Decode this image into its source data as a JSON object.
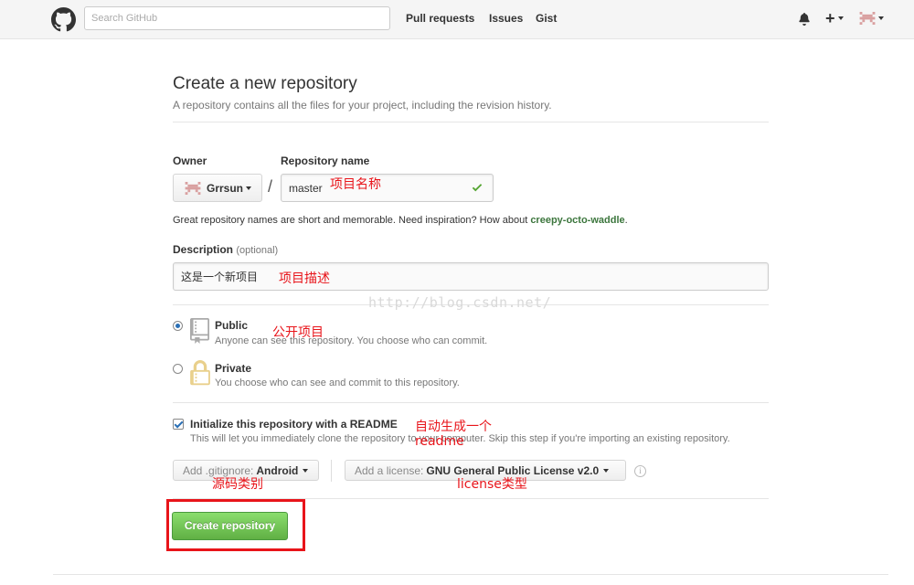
{
  "header": {
    "search_placeholder": "Search GitHub",
    "nav": [
      "Pull requests",
      "Issues",
      "Gist"
    ],
    "plus_label": "+",
    "icons": [
      "github-logo-icon",
      "bell-icon",
      "plus-icon",
      "avatar-icon"
    ]
  },
  "page": {
    "title": "Create a new repository",
    "subtitle": "A repository contains all the files for your project, including the revision history."
  },
  "owner": {
    "label": "Owner",
    "value": "Grrsun"
  },
  "repo": {
    "label": "Repository name",
    "value": "master",
    "valid": true,
    "hint_prefix": "Great repository names are short and memorable. Need inspiration? How about ",
    "suggestion": "creepy-octo-waddle",
    "hint_suffix": "."
  },
  "description": {
    "label": "Description",
    "optional": "(optional)",
    "value": "这是一个新项目"
  },
  "visibility": {
    "selected": "public",
    "public": {
      "title": "Public",
      "note": "Anyone can see this repository. You choose who can commit."
    },
    "private": {
      "title": "Private",
      "note": "You choose who can see and commit to this repository."
    }
  },
  "readme": {
    "checked": true,
    "label": "Initialize this repository with a README",
    "note": "This will let you immediately clone the repository to your computer. Skip this step if you're importing an existing repository."
  },
  "gitignore": {
    "prefix": "Add .gitignore:",
    "value": "Android"
  },
  "license": {
    "prefix": "Add a license:",
    "value": "GNU General Public License v2.0"
  },
  "create_button": "Create repository",
  "annotations": {
    "repo_name": "项目名称",
    "description": "项目描述",
    "public": "公开项目",
    "readme_line1": "自动生成一个",
    "readme_line2": "readme",
    "gitignore": "源码类别",
    "license": "license类型"
  },
  "watermark": "http://blog.csdn.net/",
  "colors": {
    "annotation": "#e8141a",
    "create_button": "#60b044",
    "suggestion": "#3c763d"
  }
}
